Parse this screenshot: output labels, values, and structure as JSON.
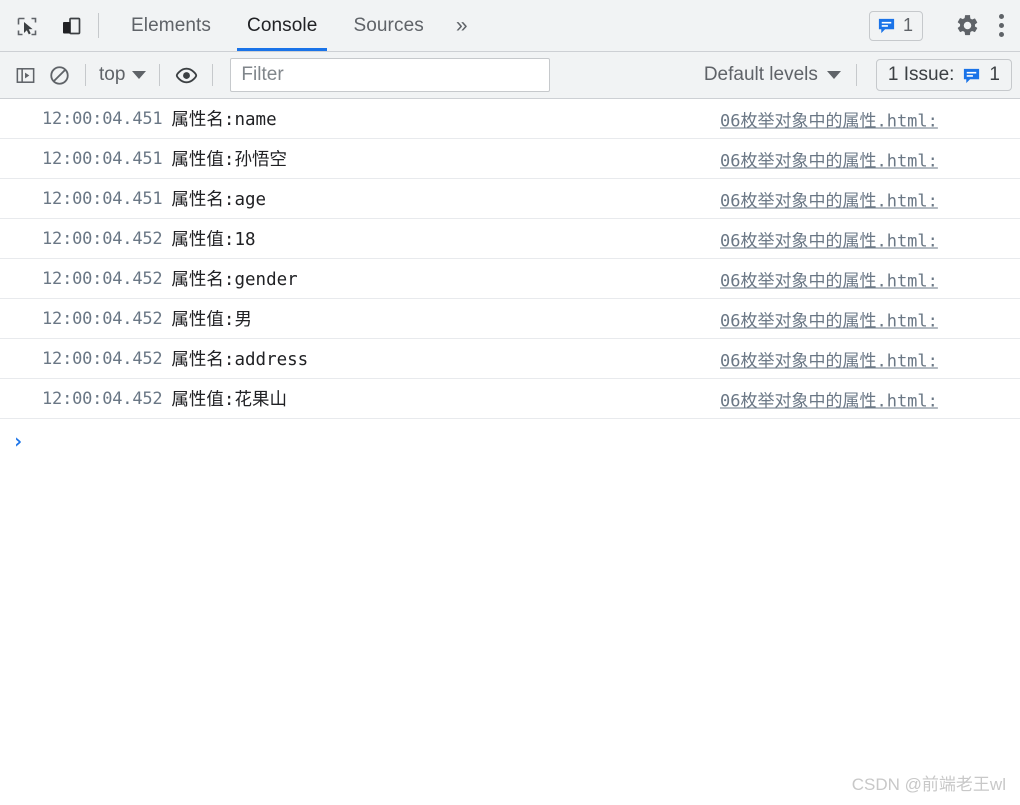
{
  "tabbar": {
    "inspect_icon": "inspect-element-icon",
    "device_icon": "device-toolbar-icon",
    "tabs": [
      {
        "label": "Elements",
        "active": false
      },
      {
        "label": "Console",
        "active": true
      },
      {
        "label": "Sources",
        "active": false
      }
    ],
    "more_tabs_label": "»",
    "issues_count": "1",
    "gear_icon": "gear-icon",
    "kebab_icon": "more-options-icon"
  },
  "console_toolbar": {
    "sidebar_toggle_icon": "console-sidebar-icon",
    "clear_icon": "clear-console-icon",
    "context": "top",
    "eye_icon": "live-expression-icon",
    "filter_placeholder": "Filter",
    "filter_value": "",
    "levels_label": "Default levels",
    "issue_label": "1 Issue:",
    "issue_count": "1"
  },
  "messages": [
    {
      "time": "12:00:04.451",
      "text": "属性名:name",
      "source": "06枚举对象中的属性.html:"
    },
    {
      "time": "12:00:04.451",
      "text": "属性值:孙悟空",
      "source": "06枚举对象中的属性.html:"
    },
    {
      "time": "12:00:04.451",
      "text": "属性名:age",
      "source": "06枚举对象中的属性.html:"
    },
    {
      "time": "12:00:04.452",
      "text": "属性值:18",
      "source": "06枚举对象中的属性.html:"
    },
    {
      "time": "12:00:04.452",
      "text": "属性名:gender",
      "source": "06枚举对象中的属性.html:"
    },
    {
      "time": "12:00:04.452",
      "text": "属性值:男",
      "source": "06枚举对象中的属性.html:"
    },
    {
      "time": "12:00:04.452",
      "text": "属性名:address",
      "source": "06枚举对象中的属性.html:"
    },
    {
      "time": "12:00:04.452",
      "text": "属性值:花果山",
      "source": "06枚举对象中的属性.html:"
    }
  ],
  "prompt": {
    "caret": "›",
    "value": ""
  },
  "watermark": "CSDN @前端老王wl",
  "colors": {
    "accent": "#1a73e8",
    "toolbar_bg": "#f1f3f4",
    "border": "#cdd0d4",
    "text": "#202124",
    "muted": "#5f6368",
    "timestamp": "#6a7785",
    "row_separator": "#e8eaed",
    "watermark": "#c8c8c8"
  }
}
